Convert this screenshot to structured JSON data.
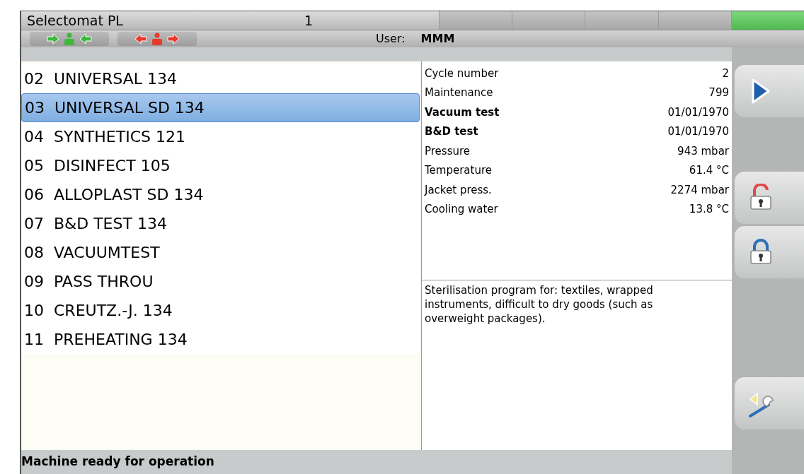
{
  "title_bar": {
    "title": "Selectomat PL",
    "number": "1",
    "segments": [
      {
        "on": false
      },
      {
        "on": false
      },
      {
        "on": false
      },
      {
        "on": false
      },
      {
        "on": true
      }
    ]
  },
  "toolbar": {
    "buttons": [
      {
        "kind": "inward",
        "color": "#3cb83c"
      },
      {
        "kind": "outward",
        "color": "#e83a2a"
      }
    ],
    "user_label": "User:",
    "user": "MMM"
  },
  "programs": [
    {
      "label": "02  UNIVERSAL 134",
      "selected": false
    },
    {
      "label": "03  UNIVERSAL SD 134",
      "selected": true
    },
    {
      "label": "04  SYNTHETICS 121",
      "selected": false
    },
    {
      "label": "05  DISINFECT 105",
      "selected": false
    },
    {
      "label": "06  ALLOPLAST SD 134",
      "selected": false
    },
    {
      "label": "07  B&D TEST 134",
      "selected": false
    },
    {
      "label": "08  VACUUMTEST",
      "selected": false
    },
    {
      "label": "09  PASS THROU",
      "selected": false
    },
    {
      "label": "10  CREUTZ.-J. 134",
      "selected": false
    },
    {
      "label": "11  PREHEATING 134",
      "selected": false
    }
  ],
  "info": [
    {
      "label": "Cycle number",
      "value": "2",
      "bold": false
    },
    {
      "label": "Maintenance",
      "value": "799",
      "bold": false
    },
    {
      "label": "Vacuum test",
      "value": "01/01/1970",
      "bold": true
    },
    {
      "label": "B&D test",
      "value": "01/01/1970",
      "bold": true
    },
    {
      "label": "Pressure",
      "value": "943 mbar",
      "bold": false
    },
    {
      "label": "Temperature",
      "value": "61.4 °C",
      "bold": false
    },
    {
      "label": "Jacket press.",
      "value": "2274 mbar",
      "bold": false
    },
    {
      "label": "Cooling water",
      "value": "13.8 °C",
      "bold": false
    }
  ],
  "description": "Sterilisation program for: textiles, wrapped instruments, difficult to dry goods (such as overweight packages).",
  "side_buttons": [
    {
      "kind": "start"
    },
    {
      "kind": "unlock"
    },
    {
      "kind": "lock"
    },
    {
      "kind": "service"
    }
  ],
  "status_bar": "Machine ready for operation"
}
